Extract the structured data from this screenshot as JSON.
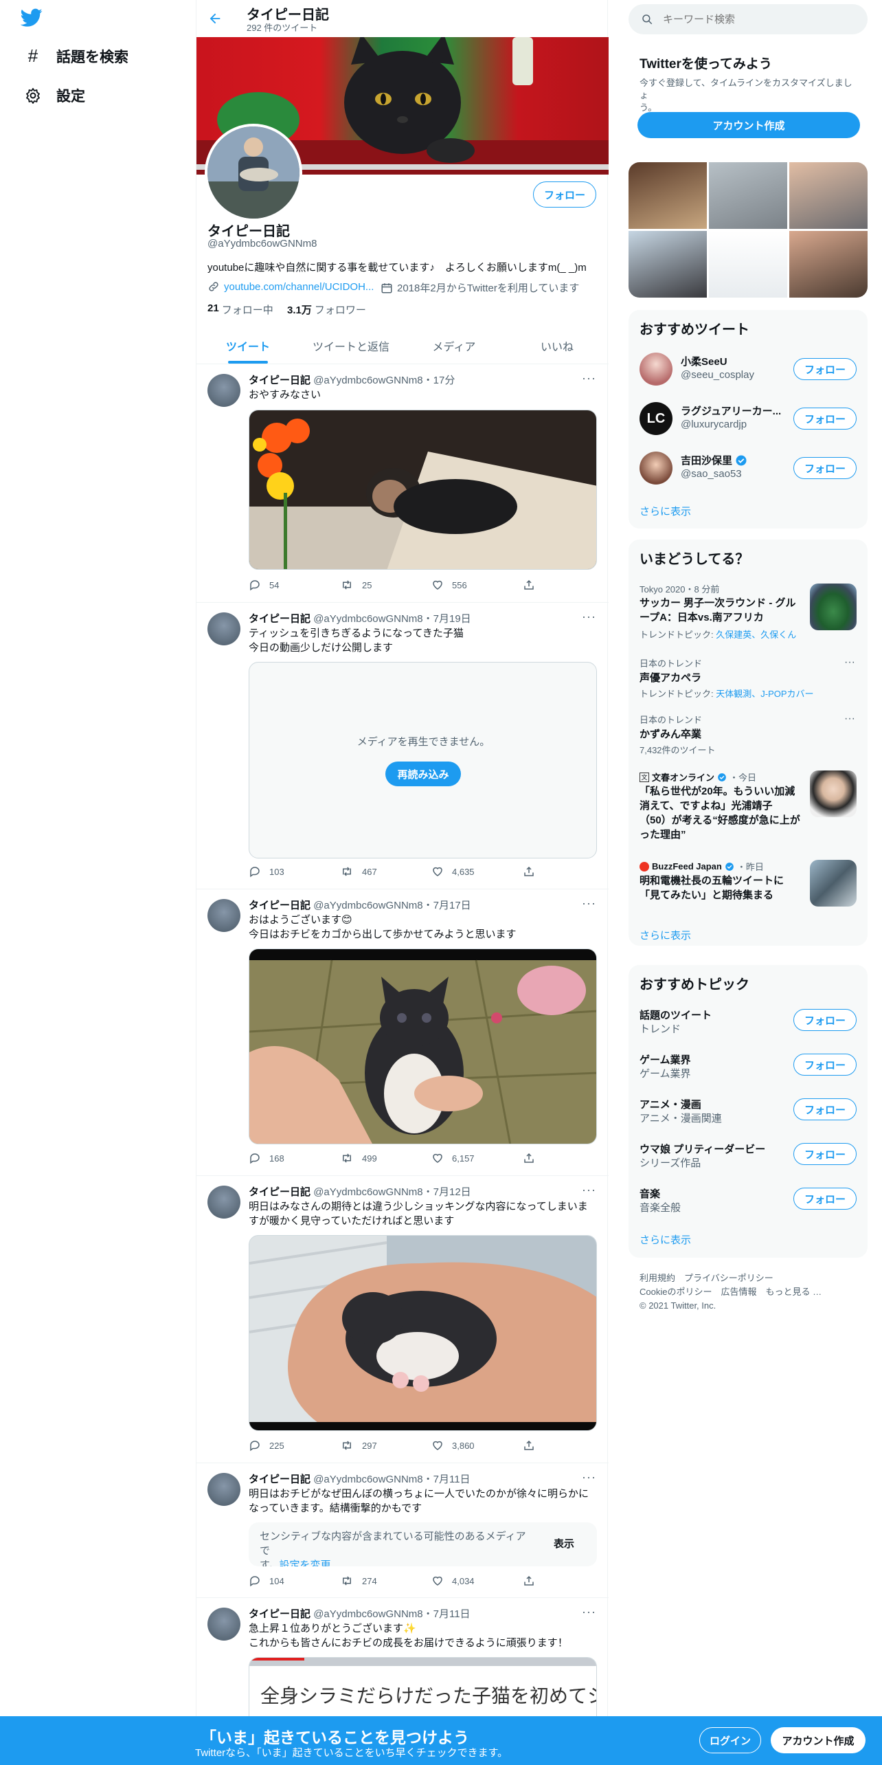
{
  "nav": {
    "explore_label": "話題を検索",
    "settings_label": "設定"
  },
  "header": {
    "title": "タイピー日記",
    "tweet_count": "292 件のツイート"
  },
  "profile": {
    "name": "タイピー日記",
    "handle": "@aYydmbc6owGNNm8",
    "bio": "youtubeに趣味や自然に関する事を載せています♪　よろしくお願いしますm(_ _)m",
    "link": "youtube.com/channel/UCIDOH...",
    "joined": "2018年2月からTwitterを利用しています",
    "following_count": "21",
    "following_label": "フォロー中",
    "followers_count": "3.1万",
    "followers_label": "フォロワー",
    "follow_button": "フォロー"
  },
  "tabs": [
    "ツイート",
    "ツイートと返信",
    "メディア",
    "いいね"
  ],
  "tweets": [
    {
      "name": "タイピー日記",
      "meta": "@aYydmbc6owGNNm8・17分",
      "lines": [
        "おやすみなさい",
        ""
      ],
      "replies": "54",
      "retweets": "25",
      "likes": "556"
    },
    {
      "name": "タイピー日記",
      "meta": "@aYydmbc6owGNNm8・7月19日",
      "lines": [
        "ティッシュを引きちぎるようになってきた子猫",
        "今日の動画少しだけ公開します"
      ],
      "media_error": "メディアを再生できません。",
      "reload_button": "再読み込み",
      "replies": "103",
      "retweets": "467",
      "likes": "4,635"
    },
    {
      "name": "タイピー日記",
      "meta": "@aYydmbc6owGNNm8・7月17日",
      "lines": [
        "おはようございます😊",
        "今日はおチビをカゴから出して歩かせてみようと思います"
      ],
      "replies": "168",
      "retweets": "499",
      "likes": "6,157"
    },
    {
      "name": "タイピー日記",
      "meta": "@aYydmbc6owGNNm8・7月12日",
      "lines": [
        "明日はみなさんの期待とは違う少しショッキングな内容になってしまいま",
        "すが暖かく見守っていただければと思います"
      ],
      "replies": "225",
      "retweets": "297",
      "likes": "3,860"
    },
    {
      "name": "タイピー日記",
      "meta": "@aYydmbc6owGNNm8・7月11日",
      "lines": [
        "明日はおチビがなぜ田んぼの横っちょに一人でいたのかが徐々に明らかに",
        "なっていきます。結構衝撃的かもです"
      ],
      "sensitive_text_1": "センシティブな内容が含まれている可能性のあるメディアで",
      "sensitive_text_2": "す。",
      "sensitive_link": "設定を変更",
      "show_button": "表示",
      "replies": "104",
      "retweets": "274",
      "likes": "4,034"
    },
    {
      "name": "タイピー日記",
      "meta": "@aYydmbc6owGNNm8・7月11日",
      "lines": [
        "急上昇１位ありがとうございます✨",
        "これからも皆さんにおチビの成長をお届けできるように頑張ります！"
      ],
      "video_title": "全身シラミだらけだった子猫を初めてシ"
    }
  ],
  "search": {
    "placeholder": "キーワード検索"
  },
  "signup": {
    "title": "Twitterを使ってみよう",
    "desc_1": "今すぐ登録して、タイムラインをカスタマイズしましょ",
    "desc_2": "う。",
    "button": "アカウント作成"
  },
  "reco_tweets": {
    "title": "おすすめツイート",
    "users": [
      {
        "name": "小柔SeeU",
        "handle": "@seeu_cosplay",
        "button": "フォロー"
      },
      {
        "name": "ラグジュアリーカー...",
        "handle": "@luxurycardjp",
        "button": "フォロー",
        "avatar_text": "LC"
      },
      {
        "name": "吉田沙保里",
        "handle": "@sao_sao53",
        "button": "フォロー"
      }
    ],
    "more": "さらに表示"
  },
  "trends": {
    "title": "いまどうしてる？",
    "items": [
      {
        "meta": "Tokyo 2020・8 分前",
        "title_1": "サッカー 男子一次ラウンド - グル",
        "title_2": "ープA：日本vs.南アフリカ",
        "topic_label": "トレンドトピック: ",
        "topic": "久保建英、久保くん"
      },
      {
        "meta": "日本のトレンド",
        "title_1": "声優アカペラ",
        "topic_label": "トレンドトピック: ",
        "topic": "天体観測、J-POPカバー"
      },
      {
        "meta": "日本のトレンド",
        "title_1": "かずみん卒業",
        "count": "7,432件のツイート"
      },
      {
        "source": "文春オンライン",
        "time": "・今日",
        "title_1": "「私ら世代が20年。もういい加減",
        "title_2": "消えて、ですよね」光浦靖子",
        "title_3": "（50）が考える“好感度が急に上が",
        "title_4": "った理由”"
      },
      {
        "source": "BuzzFeed Japan",
        "time": "・昨日",
        "title_1": "明和電機社長の五輪ツイートに",
        "title_2": "「見てみたい」と期待集まる"
      }
    ],
    "more": "さらに表示"
  },
  "topics": {
    "title": "おすすめトピック",
    "items": [
      {
        "name": "話題のツイート",
        "sub": "トレンド",
        "button": "フォロー"
      },
      {
        "name": "ゲーム業界",
        "sub": "ゲーム業界",
        "button": "フォロー"
      },
      {
        "name": "アニメ・漫画",
        "sub": "アニメ・漫画関連",
        "button": "フォロー"
      },
      {
        "name": "ウマ娘 プリティーダービー",
        "sub": "シリーズ作品",
        "button": "フォロー"
      },
      {
        "name": "音楽",
        "sub": "音楽全般",
        "button": "フォロー"
      }
    ],
    "more": "さらに表示"
  },
  "footer": {
    "links_1": "利用規約　プライバシーポリシー",
    "links_2": "Cookieのポリシー　広告情報　もっと見る …",
    "copyright": "© 2021 Twitter, Inc."
  },
  "bottom_bar": {
    "title": "「いま」起きていることを見つけよう",
    "subtitle": "Twitterなら、「いま」起きていることをいち早くチェックできます。",
    "login": "ログイン",
    "signup": "アカウント作成"
  },
  "colors": {
    "accent": "#1d9bf0",
    "text": "#0f1419",
    "muted": "#536471"
  }
}
